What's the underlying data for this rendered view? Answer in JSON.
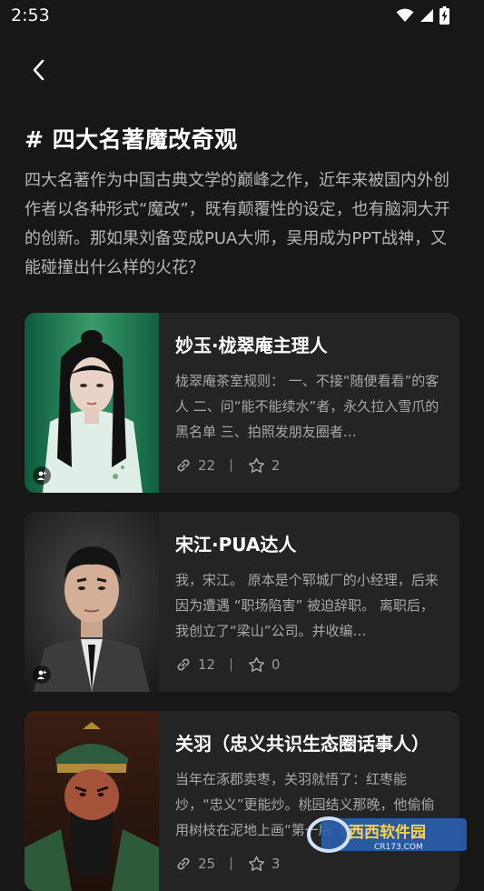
{
  "status_bar": {
    "time": "2:53"
  },
  "header": {
    "back_icon": "chevron-left-icon"
  },
  "topic": {
    "title": "# 四大名著魔改奇观",
    "description": "四大名著作为中国古典文学的巅峰之作，近年来被国内外创作者以各种形式“魔改”，既有颠覆性的设定，也有脑洞大开的创新。那如果刘备变成PUA大师，吴用成为PPT战神，又能碰撞出什么样的火花？"
  },
  "cards": [
    {
      "title": "妙玉·栊翠庵主理人",
      "text": "栊翠庵茶室规则： 一、不接“随便看看”的客人 二、问“能不能续水”者，永久拉入雪爪的黑名单 三、拍照发朋友圈者…",
      "links": "22",
      "stars": "2"
    },
    {
      "title": "宋江·PUA达人",
      "text": "我，宋江。 原本是个郓城厂的小经理，后来因为遭遇 “职场陷害” 被迫辞职。 离职后，我创立了“梁山”公司。并收编…",
      "links": "12",
      "stars": "0"
    },
    {
      "title": "关羽（忠义共识生态圈话事人）",
      "text": "当年在涿郡卖枣，关羽就悟了：红枣能炒，“忠义”更能炒。桃园结义那晚，他偷偷用树枝在泥地上画“第一版”忠义…",
      "links": "25",
      "stars": "3"
    }
  ],
  "watermark": {
    "text_main": "西西软件园",
    "text_sub": "CR173.COM"
  },
  "colors": {
    "background": "#171717",
    "card": "#242424",
    "text_secondary": "#b6b6b6"
  }
}
